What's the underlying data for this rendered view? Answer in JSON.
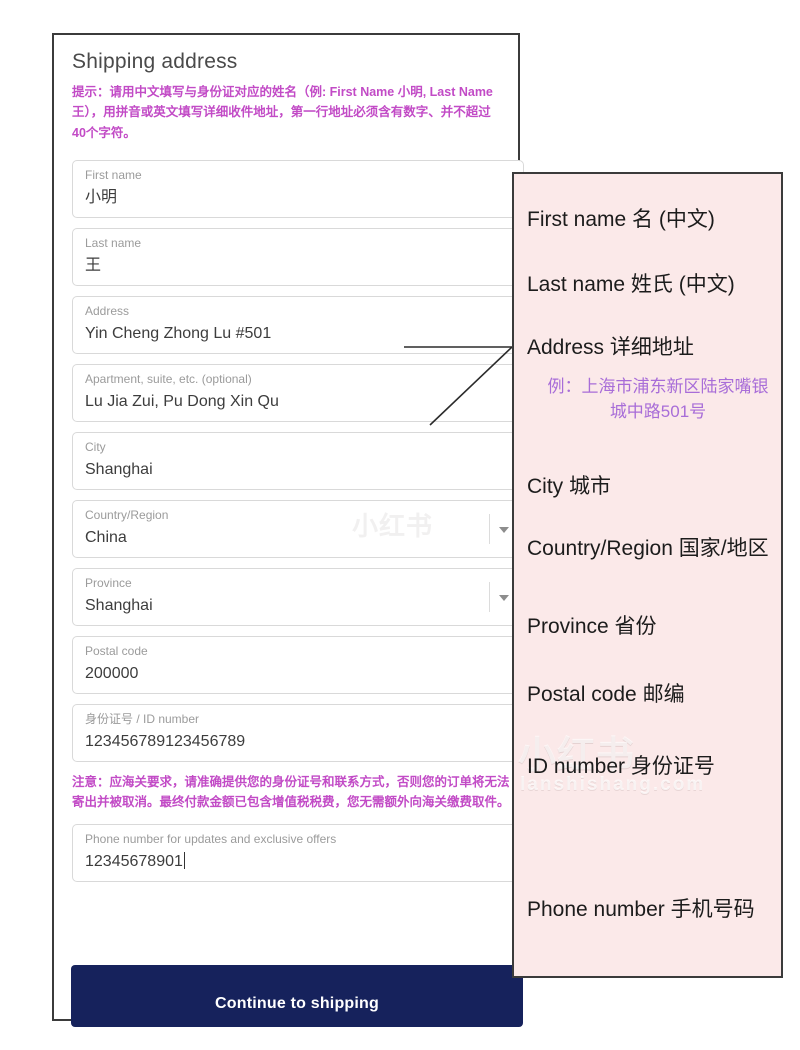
{
  "card": {
    "title": "Shipping address",
    "hint": "提示：请用中文填写与身份证对应的姓名（例: First Name 小明, Last Name 王），用拼音或英文填写详细收件地址，第一行地址必须含有数字、并不超过40个字符。",
    "notice": "注意：应海关要求，请准确提供您的身份证号和联系方式，否则您的订单将无法寄出并被取消。最终付款金额已包含增值税税费，您无需额外向海关缴费取件。",
    "submit_label": "Continue to shipping",
    "fields": [
      {
        "label": "First name",
        "value": "小明",
        "type": "text"
      },
      {
        "label": "Last name",
        "value": "王",
        "type": "text"
      },
      {
        "label": "Address",
        "value": "Yin Cheng Zhong Lu #501",
        "type": "text"
      },
      {
        "label": "Apartment, suite, etc. (optional)",
        "value": "Lu Jia Zui, Pu Dong Xin Qu",
        "type": "text"
      },
      {
        "label": "City",
        "value": "Shanghai",
        "type": "text"
      },
      {
        "label": "Country/Region",
        "value": "China",
        "type": "select"
      },
      {
        "label": "Province",
        "value": "Shanghai",
        "type": "select"
      },
      {
        "label": "Postal code",
        "value": "200000",
        "type": "text"
      },
      {
        "label": "身份证号 / ID number",
        "value": "123456789123456789",
        "type": "text"
      },
      {
        "label": "Phone number for updates and exclusive offers",
        "value": "12345678901",
        "type": "text"
      }
    ]
  },
  "annotations": [
    {
      "text": "First name 名 (中文)"
    },
    {
      "text": "Last name 姓氏 (中文)"
    },
    {
      "text": "Address 详细地址"
    },
    {
      "text": "City 城市"
    },
    {
      "text": "Country/Region 国家/地区"
    },
    {
      "text": "Province 省份"
    },
    {
      "text": "Postal code 邮编"
    },
    {
      "text": "ID number 身份证号"
    },
    {
      "text": "Phone number 手机号码"
    }
  ],
  "annotation_example": "例：上海市浦东新区陆家嘴银城中路501号",
  "watermarks": {
    "center": "小红书",
    "brand_cn": "小红书",
    "brand_url": "lanshishang.com"
  },
  "colors": {
    "hint": "#c24bc6",
    "panel_bg": "#fbe9e9",
    "button_bg": "#16225c",
    "example_text": "#a86dd8",
    "border": "#3b3b3b"
  }
}
